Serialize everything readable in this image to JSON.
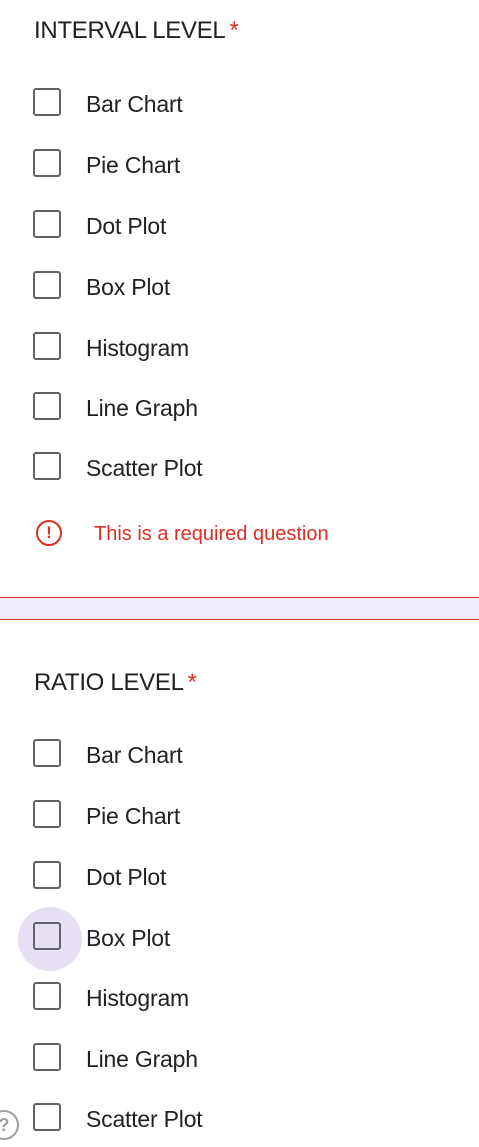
{
  "question1": {
    "title": "INTERVAL LEVEL",
    "required_marker": "*",
    "options": [
      "Bar Chart",
      "Pie Chart",
      "Dot Plot",
      "Box Plot",
      "Histogram",
      "Line Graph",
      "Scatter Plot"
    ],
    "error": {
      "icon": "error-circle-icon",
      "glyph": "!",
      "text": "This is a required question"
    }
  },
  "question2": {
    "title": "RATIO LEVEL",
    "required_marker": "*",
    "options": [
      "Bar Chart",
      "Pie Chart",
      "Dot Plot",
      "Box Plot",
      "Histogram",
      "Line Graph",
      "Scatter Plot"
    ],
    "hovered_option": "Box Plot"
  },
  "help": {
    "icon": "help-circle-icon",
    "glyph": "?"
  },
  "colors": {
    "error": "#d93025",
    "checkbox_border": "#5f6368",
    "hover_highlight": "#e7e0f2",
    "separator_fill": "#f0ebf8"
  }
}
